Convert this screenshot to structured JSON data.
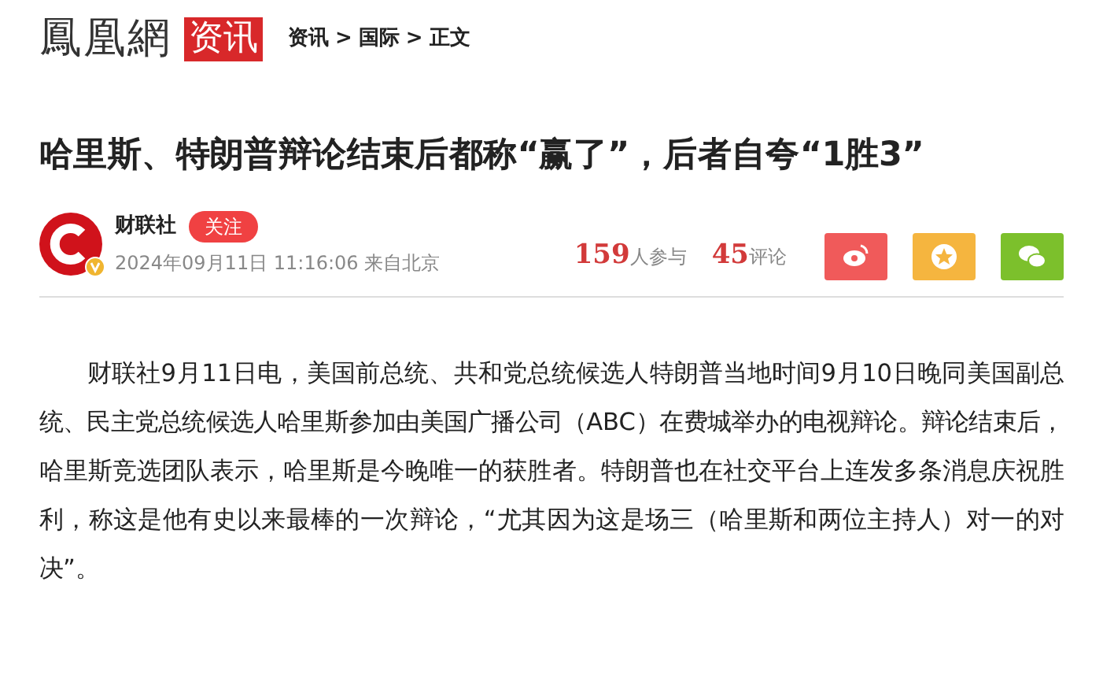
{
  "header": {
    "logo": "鳳凰網",
    "channel": "资讯",
    "breadcrumb": [
      "资讯",
      "国际",
      "正文"
    ],
    "separator": ">"
  },
  "article": {
    "title": "哈里斯、特朗普辩论结束后都称“赢了”，后者自夸“1胜3”",
    "author": {
      "name": "财联社",
      "verified": true,
      "follow_label": "关注",
      "meta": "2024年09月11日 11:16:06 来自北京"
    },
    "stats": [
      {
        "count": "159",
        "label": "人参与"
      },
      {
        "count": "45",
        "label": "评论"
      }
    ],
    "share": [
      {
        "kind": "weibo",
        "color": "#f05a5a"
      },
      {
        "kind": "favorite",
        "color": "#f5b53f"
      },
      {
        "kind": "wechat",
        "color": "#7cc02c"
      }
    ],
    "body": "财联社9月11日电，美国前总统、共和党总统候选人特朗普当地时间9月10日晚同美国副总统、民主党总统候选人哈里斯参加由美国广播公司（ABC）在费城举办的电视辩论。辩论结束后，哈里斯竞选团队表示，哈里斯是今晚唯一的获胜者。特朗普也在社交平台上连发多条消息庆祝胜利，称这是他有史以来最棒的一次辩论，“尤其因为这是场三（哈里斯和两位主持人）对一的对决”。"
  }
}
